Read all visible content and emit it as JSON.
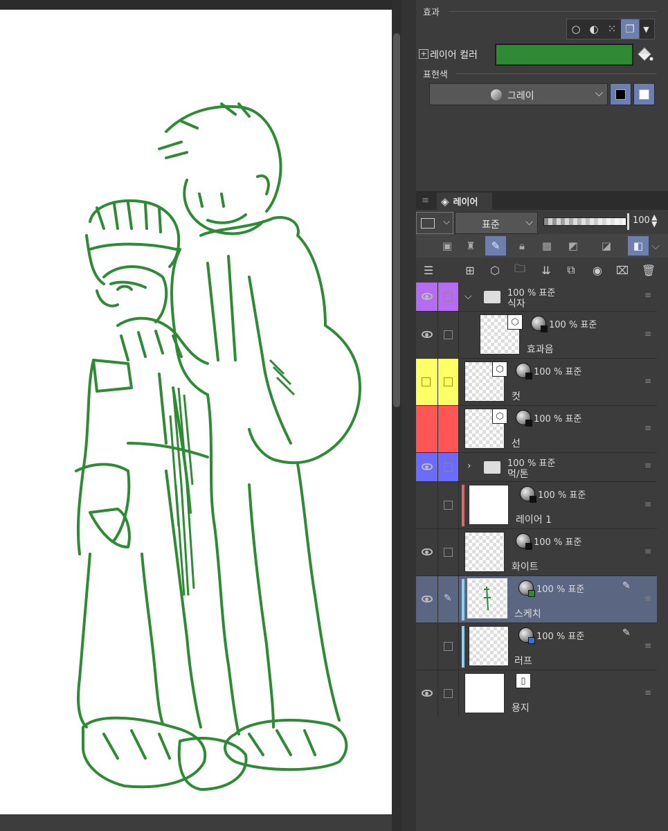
{
  "effect_panel": {
    "title": "효과",
    "layer_color_label": "레이어 컬러",
    "layer_color": "#2f8a35",
    "expression_color_title": "표현색",
    "expression_color_value": "그레이"
  },
  "layer_panel": {
    "tab_label": "레이어",
    "blend_mode": "표준",
    "opacity": "100",
    "layers": [
      {
        "status": "100 % 표준",
        "name": "식자",
        "type": "folder",
        "visible": true,
        "color": "#b56cf0"
      },
      {
        "status": "100 % 표준",
        "name": "효과음",
        "type": "vector",
        "visible": true
      },
      {
        "status": "100 % 표준",
        "name": "컷",
        "type": "vector",
        "visible": false,
        "color": "#ffff66"
      },
      {
        "status": "100 % 표준",
        "name": "선",
        "type": "vector",
        "visible": false,
        "color": "#ff5555"
      },
      {
        "status": "100 % 표준",
        "name": "먹/톤",
        "type": "folder",
        "visible": true,
        "color": "#6b6bff"
      },
      {
        "status": "100 % 표준",
        "name": "레이어 1",
        "type": "raster",
        "visible": false
      },
      {
        "status": "100 % 표준",
        "name": "화이트",
        "type": "raster",
        "visible": true
      },
      {
        "status": "100 % 표준",
        "name": "스케치",
        "type": "raster",
        "visible": true,
        "selected": true
      },
      {
        "status": "100 % 표준",
        "name": "러프",
        "type": "raster",
        "visible": false
      },
      {
        "status": "",
        "name": "용지",
        "type": "paper",
        "visible": true
      }
    ]
  },
  "colors": {
    "sketch_line": "#2f8a35",
    "selected_row": "#5b6683",
    "accent": "#6d7fae"
  }
}
